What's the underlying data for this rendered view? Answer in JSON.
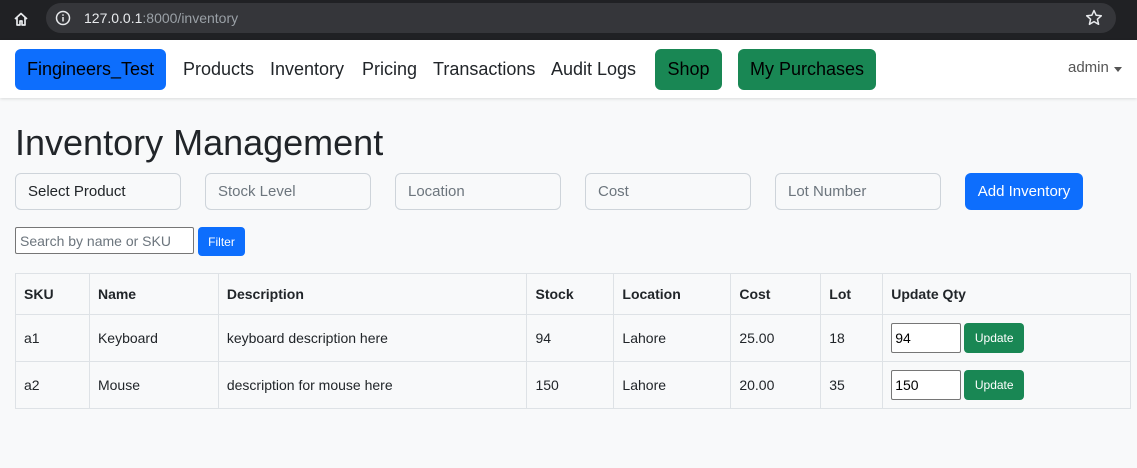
{
  "browser": {
    "url_host": "127.0.0.1",
    "url_rest": ":8000/inventory"
  },
  "navbar": {
    "brand": "Fingineers_Test",
    "links": [
      "Products",
      "Inventory",
      "Pricing",
      "Transactions",
      "Audit Logs"
    ],
    "shop": "Shop",
    "purchases": "My Purchases",
    "user": "admin"
  },
  "page": {
    "title": "Inventory Management"
  },
  "form": {
    "product_select": "Select Product",
    "stock_placeholder": "Stock Level",
    "location_placeholder": "Location",
    "cost_placeholder": "Cost",
    "lot_placeholder": "Lot Number",
    "add_button": "Add Inventory"
  },
  "search": {
    "placeholder": "Search by name or SKU",
    "filter_button": "Filter"
  },
  "table": {
    "headers": [
      "SKU",
      "Name",
      "Description",
      "Stock",
      "Location",
      "Cost",
      "Lot",
      "Update Qty"
    ],
    "rows": [
      {
        "sku": "a1",
        "name": "Keyboard",
        "description": "keyboard description here",
        "stock": "94",
        "location": "Lahore",
        "cost": "25.00",
        "lot": "18",
        "qty": "94"
      },
      {
        "sku": "a2",
        "name": "Mouse",
        "description": "description for mouse here",
        "stock": "150",
        "location": "Lahore",
        "cost": "20.00",
        "lot": "35",
        "qty": "150"
      }
    ],
    "update_button": "Update"
  },
  "colors": {
    "primary": "#0d6efd",
    "success": "#198754",
    "chrome": "#202124"
  }
}
